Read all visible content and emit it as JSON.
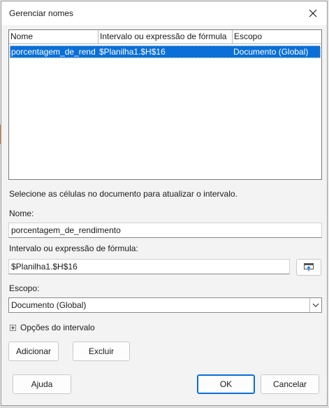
{
  "dialog": {
    "title": "Gerenciar nomes",
    "close_icon": "close-icon"
  },
  "names_list": {
    "columns": [
      "Nome",
      "Intervalo ou expressão de fórmula",
      "Escopo"
    ],
    "rows": [
      {
        "name": "porcentagem_de_rend",
        "range": "$Planilha1.$H$16",
        "scope": "Documento (Global)",
        "selected": true
      }
    ]
  },
  "instruction": "Selecione as células no documento para atualizar o intervalo.",
  "name_field": {
    "label": "Nome:",
    "value": "porcentagem_de_rendimento"
  },
  "range_field": {
    "label": "Intervalo ou expressão de fórmula:",
    "value": "$Planilha1.$H$16",
    "shrink_icon": "shrink-dialog-icon"
  },
  "scope_field": {
    "label": "Escopo:",
    "selected": "Documento (Global)",
    "dropdown_icon": "chevron-down-icon"
  },
  "range_options": {
    "label": "Opções do intervalo",
    "expand_icon": "expand-plus-icon"
  },
  "buttons": {
    "add": "Adicionar",
    "delete": "Excluir",
    "help": "Ajuda",
    "ok": "OK",
    "cancel": "Cancelar"
  },
  "colors": {
    "selection": "#0a6fd6",
    "dialog_bg": "#f3f3f3",
    "default_button_border": "#0a6fd6"
  }
}
